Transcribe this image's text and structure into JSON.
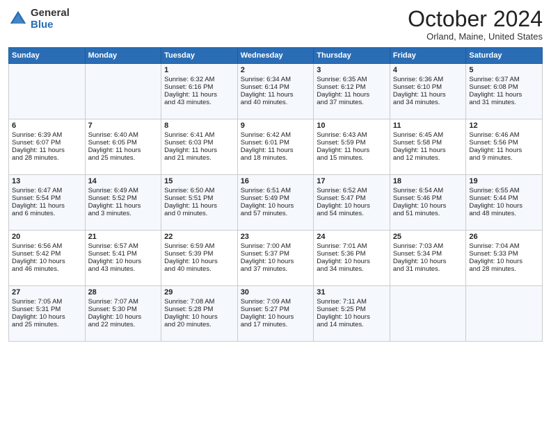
{
  "header": {
    "logo_general": "General",
    "logo_blue": "Blue",
    "month_title": "October 2024",
    "location": "Orland, Maine, United States"
  },
  "weekdays": [
    "Sunday",
    "Monday",
    "Tuesday",
    "Wednesday",
    "Thursday",
    "Friday",
    "Saturday"
  ],
  "weeks": [
    [
      {
        "day": "",
        "lines": []
      },
      {
        "day": "",
        "lines": []
      },
      {
        "day": "1",
        "lines": [
          "Sunrise: 6:32 AM",
          "Sunset: 6:16 PM",
          "Daylight: 11 hours",
          "and 43 minutes."
        ]
      },
      {
        "day": "2",
        "lines": [
          "Sunrise: 6:34 AM",
          "Sunset: 6:14 PM",
          "Daylight: 11 hours",
          "and 40 minutes."
        ]
      },
      {
        "day": "3",
        "lines": [
          "Sunrise: 6:35 AM",
          "Sunset: 6:12 PM",
          "Daylight: 11 hours",
          "and 37 minutes."
        ]
      },
      {
        "day": "4",
        "lines": [
          "Sunrise: 6:36 AM",
          "Sunset: 6:10 PM",
          "Daylight: 11 hours",
          "and 34 minutes."
        ]
      },
      {
        "day": "5",
        "lines": [
          "Sunrise: 6:37 AM",
          "Sunset: 6:08 PM",
          "Daylight: 11 hours",
          "and 31 minutes."
        ]
      }
    ],
    [
      {
        "day": "6",
        "lines": [
          "Sunrise: 6:39 AM",
          "Sunset: 6:07 PM",
          "Daylight: 11 hours",
          "and 28 minutes."
        ]
      },
      {
        "day": "7",
        "lines": [
          "Sunrise: 6:40 AM",
          "Sunset: 6:05 PM",
          "Daylight: 11 hours",
          "and 25 minutes."
        ]
      },
      {
        "day": "8",
        "lines": [
          "Sunrise: 6:41 AM",
          "Sunset: 6:03 PM",
          "Daylight: 11 hours",
          "and 21 minutes."
        ]
      },
      {
        "day": "9",
        "lines": [
          "Sunrise: 6:42 AM",
          "Sunset: 6:01 PM",
          "Daylight: 11 hours",
          "and 18 minutes."
        ]
      },
      {
        "day": "10",
        "lines": [
          "Sunrise: 6:43 AM",
          "Sunset: 5:59 PM",
          "Daylight: 11 hours",
          "and 15 minutes."
        ]
      },
      {
        "day": "11",
        "lines": [
          "Sunrise: 6:45 AM",
          "Sunset: 5:58 PM",
          "Daylight: 11 hours",
          "and 12 minutes."
        ]
      },
      {
        "day": "12",
        "lines": [
          "Sunrise: 6:46 AM",
          "Sunset: 5:56 PM",
          "Daylight: 11 hours",
          "and 9 minutes."
        ]
      }
    ],
    [
      {
        "day": "13",
        "lines": [
          "Sunrise: 6:47 AM",
          "Sunset: 5:54 PM",
          "Daylight: 11 hours",
          "and 6 minutes."
        ]
      },
      {
        "day": "14",
        "lines": [
          "Sunrise: 6:49 AM",
          "Sunset: 5:52 PM",
          "Daylight: 11 hours",
          "and 3 minutes."
        ]
      },
      {
        "day": "15",
        "lines": [
          "Sunrise: 6:50 AM",
          "Sunset: 5:51 PM",
          "Daylight: 11 hours",
          "and 0 minutes."
        ]
      },
      {
        "day": "16",
        "lines": [
          "Sunrise: 6:51 AM",
          "Sunset: 5:49 PM",
          "Daylight: 10 hours",
          "and 57 minutes."
        ]
      },
      {
        "day": "17",
        "lines": [
          "Sunrise: 6:52 AM",
          "Sunset: 5:47 PM",
          "Daylight: 10 hours",
          "and 54 minutes."
        ]
      },
      {
        "day": "18",
        "lines": [
          "Sunrise: 6:54 AM",
          "Sunset: 5:46 PM",
          "Daylight: 10 hours",
          "and 51 minutes."
        ]
      },
      {
        "day": "19",
        "lines": [
          "Sunrise: 6:55 AM",
          "Sunset: 5:44 PM",
          "Daylight: 10 hours",
          "and 48 minutes."
        ]
      }
    ],
    [
      {
        "day": "20",
        "lines": [
          "Sunrise: 6:56 AM",
          "Sunset: 5:42 PM",
          "Daylight: 10 hours",
          "and 46 minutes."
        ]
      },
      {
        "day": "21",
        "lines": [
          "Sunrise: 6:57 AM",
          "Sunset: 5:41 PM",
          "Daylight: 10 hours",
          "and 43 minutes."
        ]
      },
      {
        "day": "22",
        "lines": [
          "Sunrise: 6:59 AM",
          "Sunset: 5:39 PM",
          "Daylight: 10 hours",
          "and 40 minutes."
        ]
      },
      {
        "day": "23",
        "lines": [
          "Sunrise: 7:00 AM",
          "Sunset: 5:37 PM",
          "Daylight: 10 hours",
          "and 37 minutes."
        ]
      },
      {
        "day": "24",
        "lines": [
          "Sunrise: 7:01 AM",
          "Sunset: 5:36 PM",
          "Daylight: 10 hours",
          "and 34 minutes."
        ]
      },
      {
        "day": "25",
        "lines": [
          "Sunrise: 7:03 AM",
          "Sunset: 5:34 PM",
          "Daylight: 10 hours",
          "and 31 minutes."
        ]
      },
      {
        "day": "26",
        "lines": [
          "Sunrise: 7:04 AM",
          "Sunset: 5:33 PM",
          "Daylight: 10 hours",
          "and 28 minutes."
        ]
      }
    ],
    [
      {
        "day": "27",
        "lines": [
          "Sunrise: 7:05 AM",
          "Sunset: 5:31 PM",
          "Daylight: 10 hours",
          "and 25 minutes."
        ]
      },
      {
        "day": "28",
        "lines": [
          "Sunrise: 7:07 AM",
          "Sunset: 5:30 PM",
          "Daylight: 10 hours",
          "and 22 minutes."
        ]
      },
      {
        "day": "29",
        "lines": [
          "Sunrise: 7:08 AM",
          "Sunset: 5:28 PM",
          "Daylight: 10 hours",
          "and 20 minutes."
        ]
      },
      {
        "day": "30",
        "lines": [
          "Sunrise: 7:09 AM",
          "Sunset: 5:27 PM",
          "Daylight: 10 hours",
          "and 17 minutes."
        ]
      },
      {
        "day": "31",
        "lines": [
          "Sunrise: 7:11 AM",
          "Sunset: 5:25 PM",
          "Daylight: 10 hours",
          "and 14 minutes."
        ]
      },
      {
        "day": "",
        "lines": []
      },
      {
        "day": "",
        "lines": []
      }
    ]
  ]
}
